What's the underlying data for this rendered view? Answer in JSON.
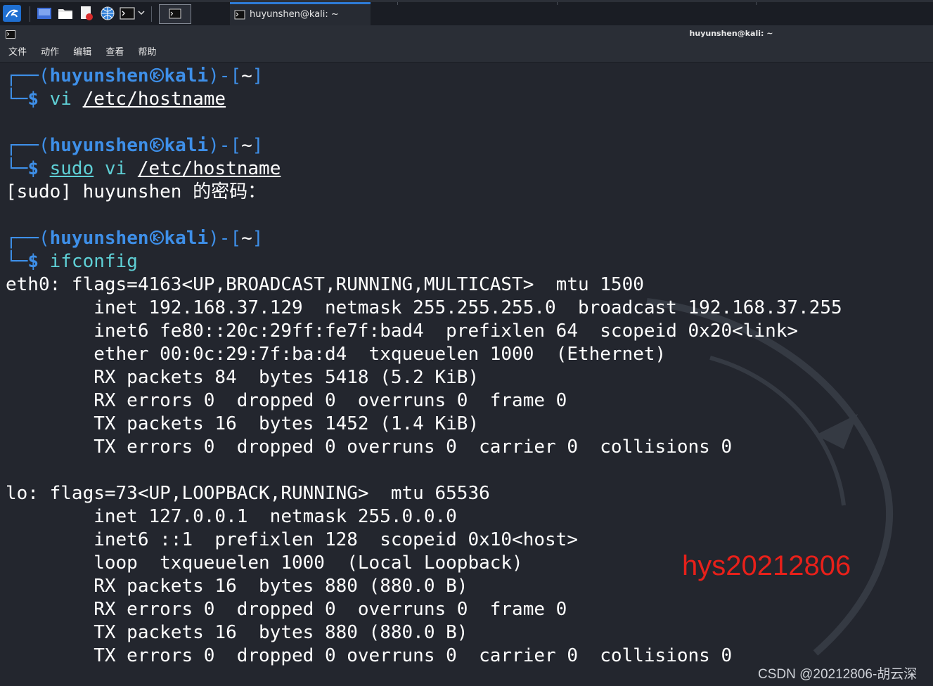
{
  "panel": {
    "task_tab_title": "huyunshen@kali: ~"
  },
  "window": {
    "title": "huyunshen@kali: ~"
  },
  "menu": {
    "items": [
      "文件",
      "动作",
      "编辑",
      "查看",
      "帮助"
    ]
  },
  "terminal": {
    "prompt": {
      "user": "huyunshen",
      "host": "kali",
      "dir": "~",
      "symbol": "$"
    },
    "cmd1": {
      "name": "vi",
      "arg": "/etc/hostname"
    },
    "cmd2": {
      "sudo": "sudo",
      "name": "vi",
      "arg": "/etc/hostname"
    },
    "sudo_prompt": "[sudo] huyunshen 的密码：",
    "cmd3": {
      "name": "ifconfig"
    },
    "output": [
      "eth0: flags=4163<UP,BROADCAST,RUNNING,MULTICAST>  mtu 1500",
      "        inet 192.168.37.129  netmask 255.255.255.0  broadcast 192.168.37.255",
      "        inet6 fe80::20c:29ff:fe7f:bad4  prefixlen 64  scopeid 0x20<link>",
      "        ether 00:0c:29:7f:ba:d4  txqueuelen 1000  (Ethernet)",
      "        RX packets 84  bytes 5418 (5.2 KiB)",
      "        RX errors 0  dropped 0  overruns 0  frame 0",
      "        TX packets 16  bytes 1452 (1.4 KiB)",
      "        TX errors 0  dropped 0 overruns 0  carrier 0  collisions 0",
      "",
      "lo: flags=73<UP,LOOPBACK,RUNNING>  mtu 65536",
      "        inet 127.0.0.1  netmask 255.0.0.0",
      "        inet6 ::1  prefixlen 128  scopeid 0x10<host>",
      "        loop  txqueuelen 1000  (Local Loopback)",
      "        RX packets 16  bytes 880 (880.0 B)",
      "        RX errors 0  dropped 0  overruns 0  frame 0",
      "        TX packets 16  bytes 880 (880.0 B)",
      "        TX errors 0  dropped 0 overruns 0  carrier 0  collisions 0"
    ]
  },
  "overlays": {
    "student_id": "hys20212806",
    "watermark": "CSDN @20212806-胡云深"
  },
  "colors": {
    "prompt_blue": "#3e8fe8",
    "command_cyan": "#5fd0d6",
    "terminal_bg": "#23262e",
    "overlay_red": "#e8201a"
  }
}
